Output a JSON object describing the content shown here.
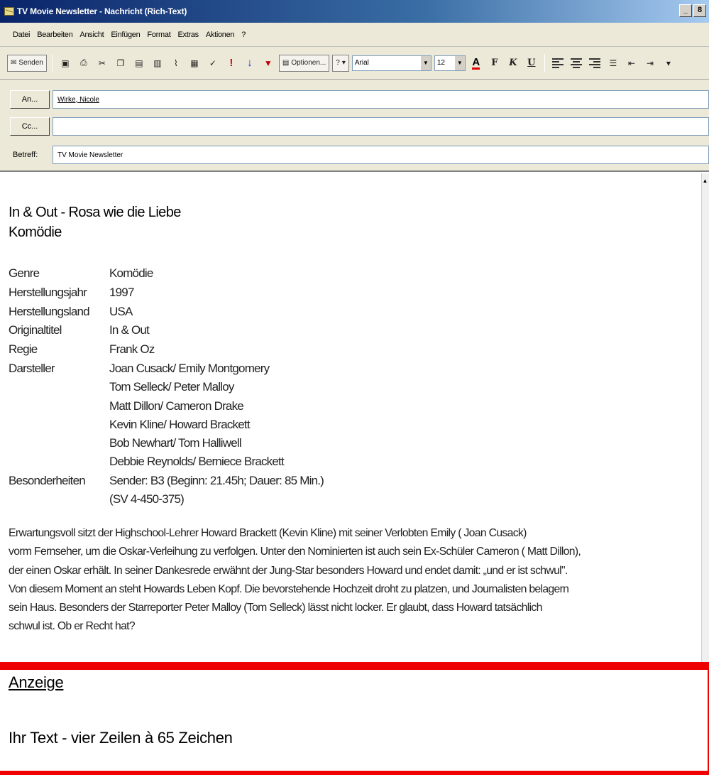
{
  "window": {
    "title": "TV Movie Newsletter - Nachricht (Rich-Text)",
    "controls": [
      "_",
      "8",
      "×"
    ]
  },
  "menu": [
    "Datei",
    "Bearbeiten",
    "Ansicht",
    "Einfügen",
    "Format",
    "Extras",
    "Aktionen",
    "?"
  ],
  "toolbar": {
    "send_label": "Senden",
    "options_label": "Optionen...",
    "font": "Arial",
    "size": "12",
    "bold": "F",
    "italic": "K",
    "underline": "U",
    "font_color": "A"
  },
  "fields": {
    "to_button": "An...",
    "cc_button": "Cc...",
    "subject_label": "Betreff:",
    "to_value": "Wirke, Nicole",
    "cc_value": "",
    "subject_value": "TV Movie Newsletter"
  },
  "message": {
    "title": "In & Out - Rosa wie die Liebe",
    "genre_heading": "Komödie",
    "info": [
      {
        "key": "Genre",
        "value": "Komödie"
      },
      {
        "key": "Herstellungsjahr",
        "value": "1997"
      },
      {
        "key": "Herstellungsland",
        "value": "USA"
      },
      {
        "key": "Originaltitel",
        "value": "In & Out"
      },
      {
        "key": "Regie",
        "value": "Frank Oz"
      }
    ],
    "cast_label": "Darsteller",
    "cast": [
      "Joan Cusack/ Emily Montgomery",
      "Tom Selleck/ Peter Malloy",
      "Matt Dillon/ Cameron Drake",
      "Kevin Kline/ Howard Brackett",
      "Bob Newhart/ Tom Halliwell",
      "Debbie Reynolds/ Berniece Brackett"
    ],
    "special_label": "Besonderheiten",
    "special": [
      "Sender: B3 (Beginn: 21.45h; Dauer: 85 Min.)",
      "(SV 4-450-375)"
    ],
    "description": [
      "Erwartungsvoll sitzt der Highschool-Lehrer Howard Brackett (Kevin Kline) mit seiner Verlobten Emily ( Joan Cusack)",
      "vorm Fernseher, um die Oskar-Verleihung zu verfolgen. Unter den Nominierten ist auch sein Ex-Schüler Cameron ( Matt Dillon),",
      "der einen Oskar erhält. In seiner Dankesrede erwähnt der Jung-Star besonders Howard und endet damit: „und er ist schwul\".",
      "Von diesem Moment an steht Howards Leben Kopf. Die bevorstehende Hochzeit droht zu platzen, und Journalisten belagern",
      "sein Haus. Besonders der Starreporter Peter Malloy (Tom Selleck) lässt nicht locker. Er glaubt, dass  Howard tatsächlich",
      "schwul ist. Ob er Recht hat?"
    ],
    "ad_title": "Anzeige",
    "ad_text": "Ihr Text - vier Zeilen à 65 Zeichen"
  },
  "colors": {
    "titlebar": "#0a246a",
    "chrome": "#ece9d8",
    "ad_border": "#ee0000"
  }
}
